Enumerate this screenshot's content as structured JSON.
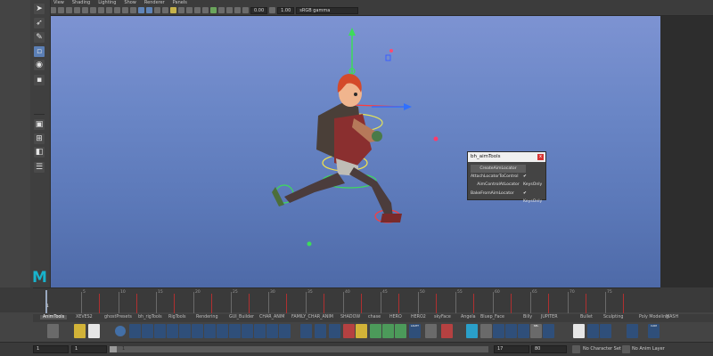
{
  "menu": {
    "items": [
      "View",
      "Shading",
      "Lighting",
      "Show",
      "Renderer",
      "Panels"
    ]
  },
  "panel_toolbar": {
    "field1": "0.00",
    "field2": "1.00",
    "colorspace": "sRGB gamma"
  },
  "aim_tools": {
    "title": "bh_aimTools",
    "close_label": "x",
    "btn_create": "CreateAimLocator",
    "btn_attach": "AttachLocatorToControl",
    "btn_aim": "AimControlAtLocator",
    "btn_bake": "BakeFromAimLocator",
    "check1_label": "KeysOnly",
    "check2_label": "KeysOnly",
    "check_mark": "✔"
  },
  "timeline": {
    "frame_label": "1",
    "ticks": [
      "5",
      "10",
      "15",
      "20",
      "25",
      "30",
      "35",
      "40",
      "45",
      "50",
      "55",
      "60",
      "65",
      "70",
      "75"
    ]
  },
  "shelf": {
    "tabs": [
      "AnimTools",
      "XEVES2",
      "ghostPresets",
      "bh_rigTools",
      "RigTools",
      "Rendering",
      "GUI_Builder",
      "CHAR_ANIM",
      "FAMILY_CHAR_ANIM",
      "SHADOW",
      "chase",
      "HERO",
      "HERO2",
      "skyFace",
      "Angela",
      "Bluep_Face",
      "Billy",
      "JUPITER",
      "Bullet",
      "Sculpting",
      "Poly Modeling",
      "MASH"
    ],
    "active_tab": "AnimTools",
    "btn_light": "LIGHT",
    "btn_sel": "SEL",
    "btn_cam": "CAM"
  },
  "bottom": {
    "start_frame": "1",
    "current_frame": "1",
    "slider_label": "1",
    "end_frame": "17",
    "end_frame2": "80",
    "character_set": "No Character Set",
    "anim_layer": "No Anim Layer"
  },
  "logo": {
    "letter": "M"
  },
  "colors": {
    "viewport_top": "#7d93d2",
    "viewport_bottom": "#4e6aa8",
    "accent": "#18b3cc",
    "close_red": "#d63434"
  }
}
